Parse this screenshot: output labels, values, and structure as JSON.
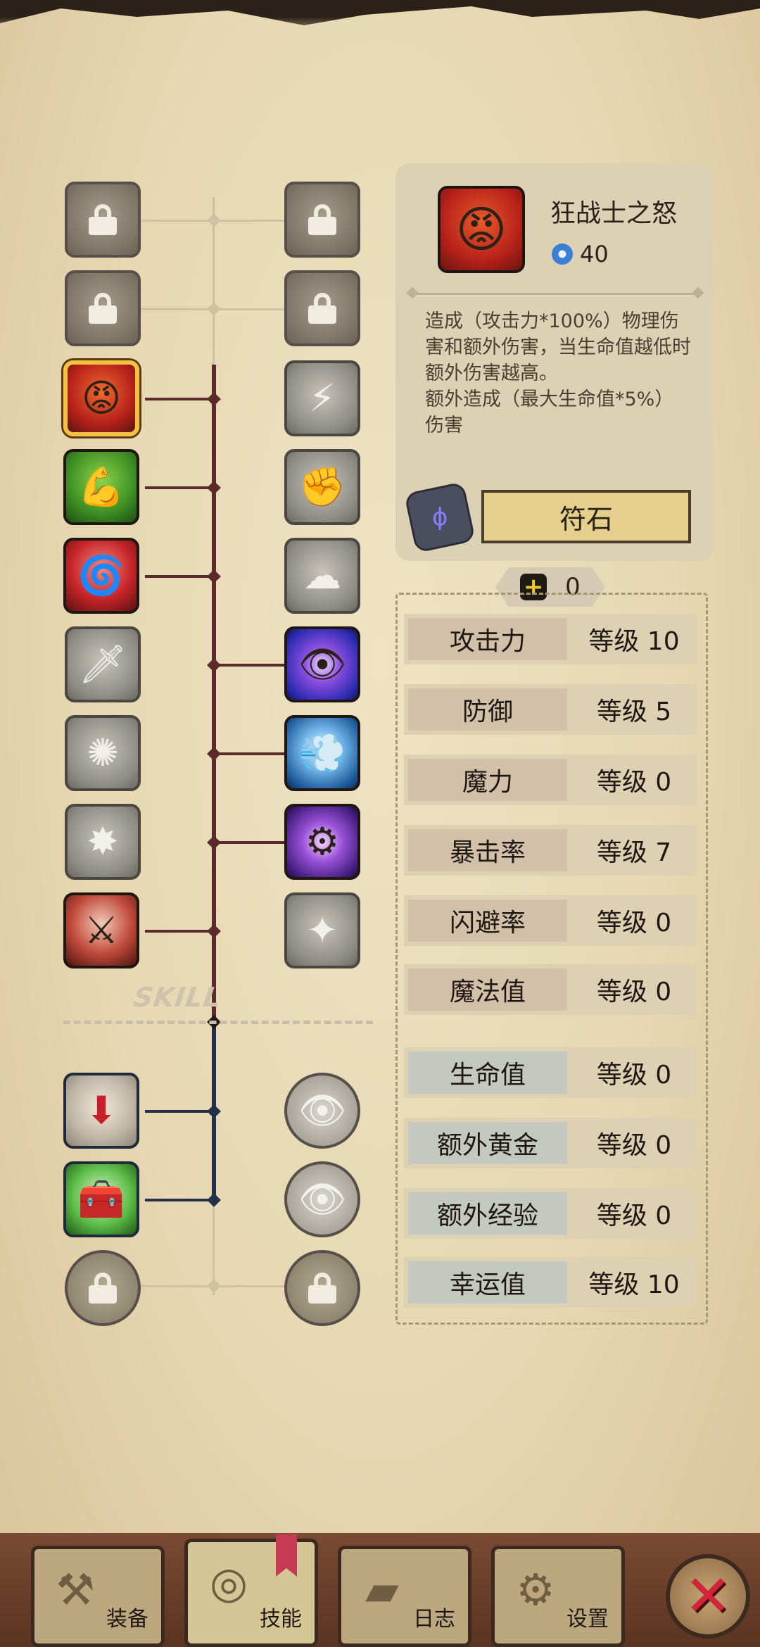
{
  "info": {
    "title": "狂战士之怒",
    "cost": "40",
    "description": "造成（攻击力*100%）物理伤害和额外伤害，当生命值越低时额外伤害越高。\n额外造成（最大生命值*5%）伤害",
    "rune_label": "符石"
  },
  "points": "0",
  "stats": [
    {
      "name": "攻击力",
      "level": "等级 10"
    },
    {
      "name": "防御",
      "level": "等级 5"
    },
    {
      "name": "魔力",
      "level": "等级 0"
    },
    {
      "name": "暴击率",
      "level": "等级 7"
    },
    {
      "name": "闪避率",
      "level": "等级 0"
    },
    {
      "name": "魔法值",
      "level": "等级 0"
    },
    {
      "name": "生命值",
      "level": "等级 0"
    },
    {
      "name": "额外黄金",
      "level": "等级 0"
    },
    {
      "name": "额外经验",
      "level": "等级 0"
    },
    {
      "name": "幸运值",
      "level": "等级 10"
    }
  ],
  "skill_tree": {
    "divider_label": "SKILL"
  },
  "nav": {
    "equipment": "装备",
    "skills": "技能",
    "log": "日志",
    "settings": "设置"
  },
  "colors": {
    "tree_active_upper": "#5b2b2b",
    "tree_active_lower": "#233049",
    "selected_border": "#f4c23f",
    "close": "#d3253a"
  }
}
